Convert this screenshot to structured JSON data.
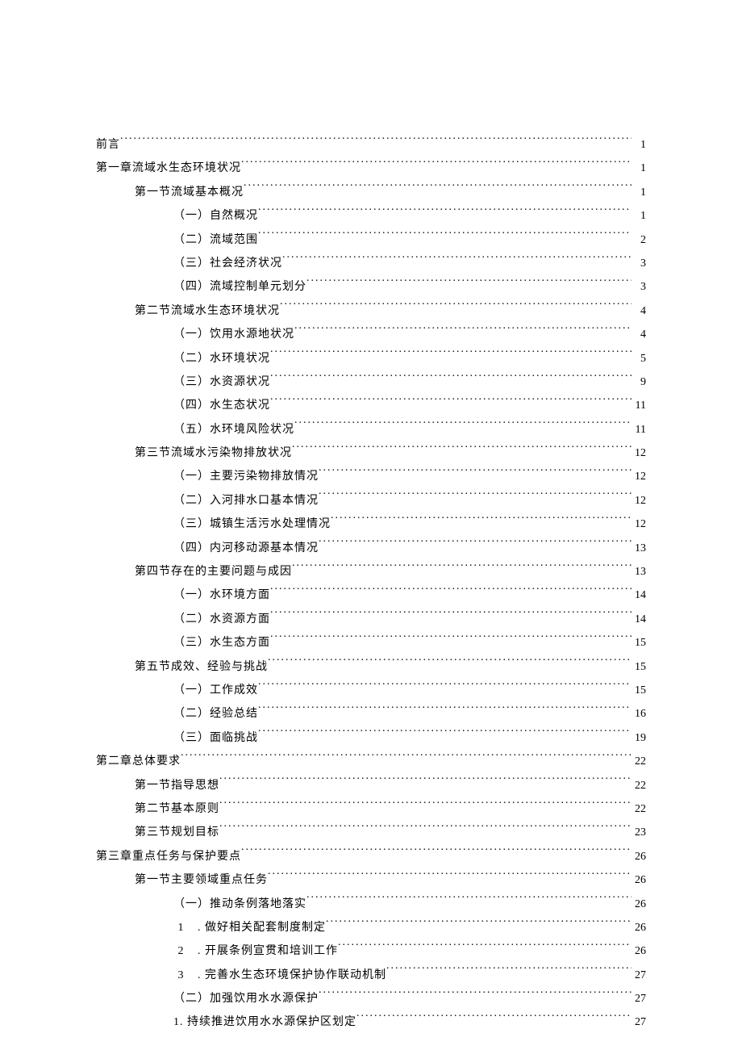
{
  "toc": [
    {
      "level": 0,
      "label": "前言",
      "page": "1"
    },
    {
      "level": 0,
      "label": "第一章流域水生态环境状况",
      "page": "1"
    },
    {
      "level": 1,
      "label": "第一节流域基本概况",
      "page": "1"
    },
    {
      "level": 2,
      "label": "（一）自然概况",
      "page": "1"
    },
    {
      "level": 2,
      "label": "（二）流域范围",
      "page": "2"
    },
    {
      "level": 2,
      "label": "（三）社会经济状况",
      "page": "3"
    },
    {
      "level": 2,
      "label": "（四）流域控制单元划分",
      "page": "3"
    },
    {
      "level": 1,
      "label": "第二节流域水生态环境状况",
      "page": "4"
    },
    {
      "level": 2,
      "label": "（一）饮用水源地状况",
      "page": "4"
    },
    {
      "level": 2,
      "label": "（二）水环境状况",
      "page": "5"
    },
    {
      "level": 2,
      "label": "（三）水资源状况",
      "page": "9"
    },
    {
      "level": 2,
      "label": "（四）水生态状况",
      "page": "11"
    },
    {
      "level": 2,
      "label": "（五）水环境风险状况",
      "page": "11"
    },
    {
      "level": 1,
      "label": "第三节流域水污染物排放状况",
      "page": "12"
    },
    {
      "level": 2,
      "label": "（一）主要污染物排放情况",
      "page": "12"
    },
    {
      "level": 2,
      "label": "（二）入河排水口基本情况",
      "page": "12"
    },
    {
      "level": 2,
      "label": "（三）城镇生活污水处理情况",
      "page": "12"
    },
    {
      "level": 2,
      "label": "（四）内河移动源基本情况",
      "page": "13"
    },
    {
      "level": 1,
      "label": "第四节存在的主要问题与成因",
      "page": "13"
    },
    {
      "level": 2,
      "label": "（一）水环境方面",
      "page": "14"
    },
    {
      "level": 2,
      "label": "（二）水资源方面",
      "page": "14"
    },
    {
      "level": 2,
      "label": "（三）水生态方面",
      "page": "15"
    },
    {
      "level": 1,
      "label": "第五节成效、经验与挑战",
      "page": "15"
    },
    {
      "level": 2,
      "label": "（一）工作成效",
      "page": "15"
    },
    {
      "level": 2,
      "label": "（二）经验总结",
      "page": "16"
    },
    {
      "level": 2,
      "label": "（三）面临挑战",
      "page": "19"
    },
    {
      "level": 0,
      "label": "第二章总体要求",
      "page": "22"
    },
    {
      "level": 1,
      "label": "第一节指导思想",
      "page": "22"
    },
    {
      "level": 1,
      "label": "第二节基本原则",
      "page": "22"
    },
    {
      "level": 1,
      "label": "第三节规划目标",
      "page": "23"
    },
    {
      "level": 0,
      "label": "第三章重点任务与保护要点",
      "page": "26"
    },
    {
      "level": 1,
      "label": "第一节主要领域重点任务",
      "page": "26"
    },
    {
      "level": 2,
      "label": "（一）推动条例落地落实",
      "page": "26"
    },
    {
      "level": 3,
      "num": "1",
      "label": ". 做好相关配套制度制定",
      "page": "26"
    },
    {
      "level": 3,
      "num": "2",
      "label": ". 开展条例宣贯和培训工作",
      "page": "26"
    },
    {
      "level": 3,
      "num": "3",
      "label": ". 完善水生态环境保护协作联动机制",
      "page": "27"
    },
    {
      "level": 2,
      "label": "（二）加强饮用水水源保护",
      "page": "27"
    },
    {
      "level": 2,
      "label": "1. 持续推进饮用水水源保护区划定",
      "page": "27"
    }
  ]
}
